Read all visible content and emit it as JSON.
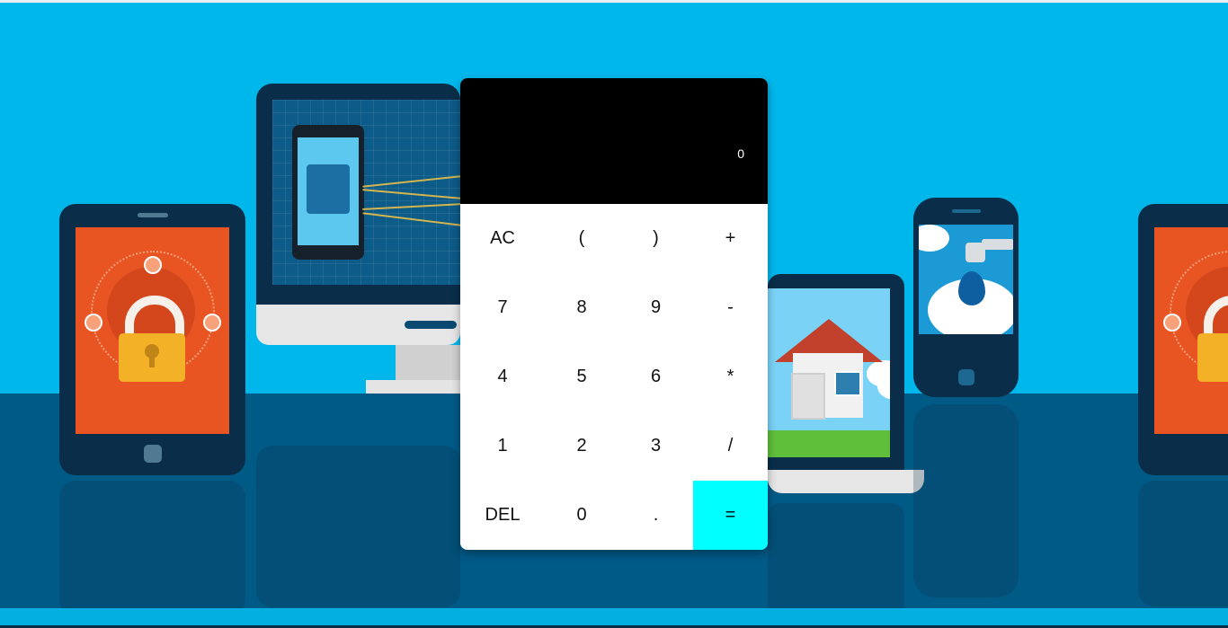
{
  "calculator": {
    "display": "0",
    "rows": [
      [
        "AC",
        "(",
        ")",
        "+"
      ],
      [
        "7",
        "8",
        "9",
        "-"
      ],
      [
        "4",
        "5",
        "6",
        "*"
      ],
      [
        "1",
        "2",
        "3",
        "/"
      ],
      [
        "DEL",
        "0",
        ".",
        "="
      ]
    ]
  },
  "colors": {
    "background": "#00b7ec",
    "floor": "#005a86",
    "display_bg": "#000000",
    "equals_key": "#00ffff"
  },
  "icons": [
    "lock-icon",
    "phone-icon",
    "house-icon",
    "water-drop-icon"
  ]
}
